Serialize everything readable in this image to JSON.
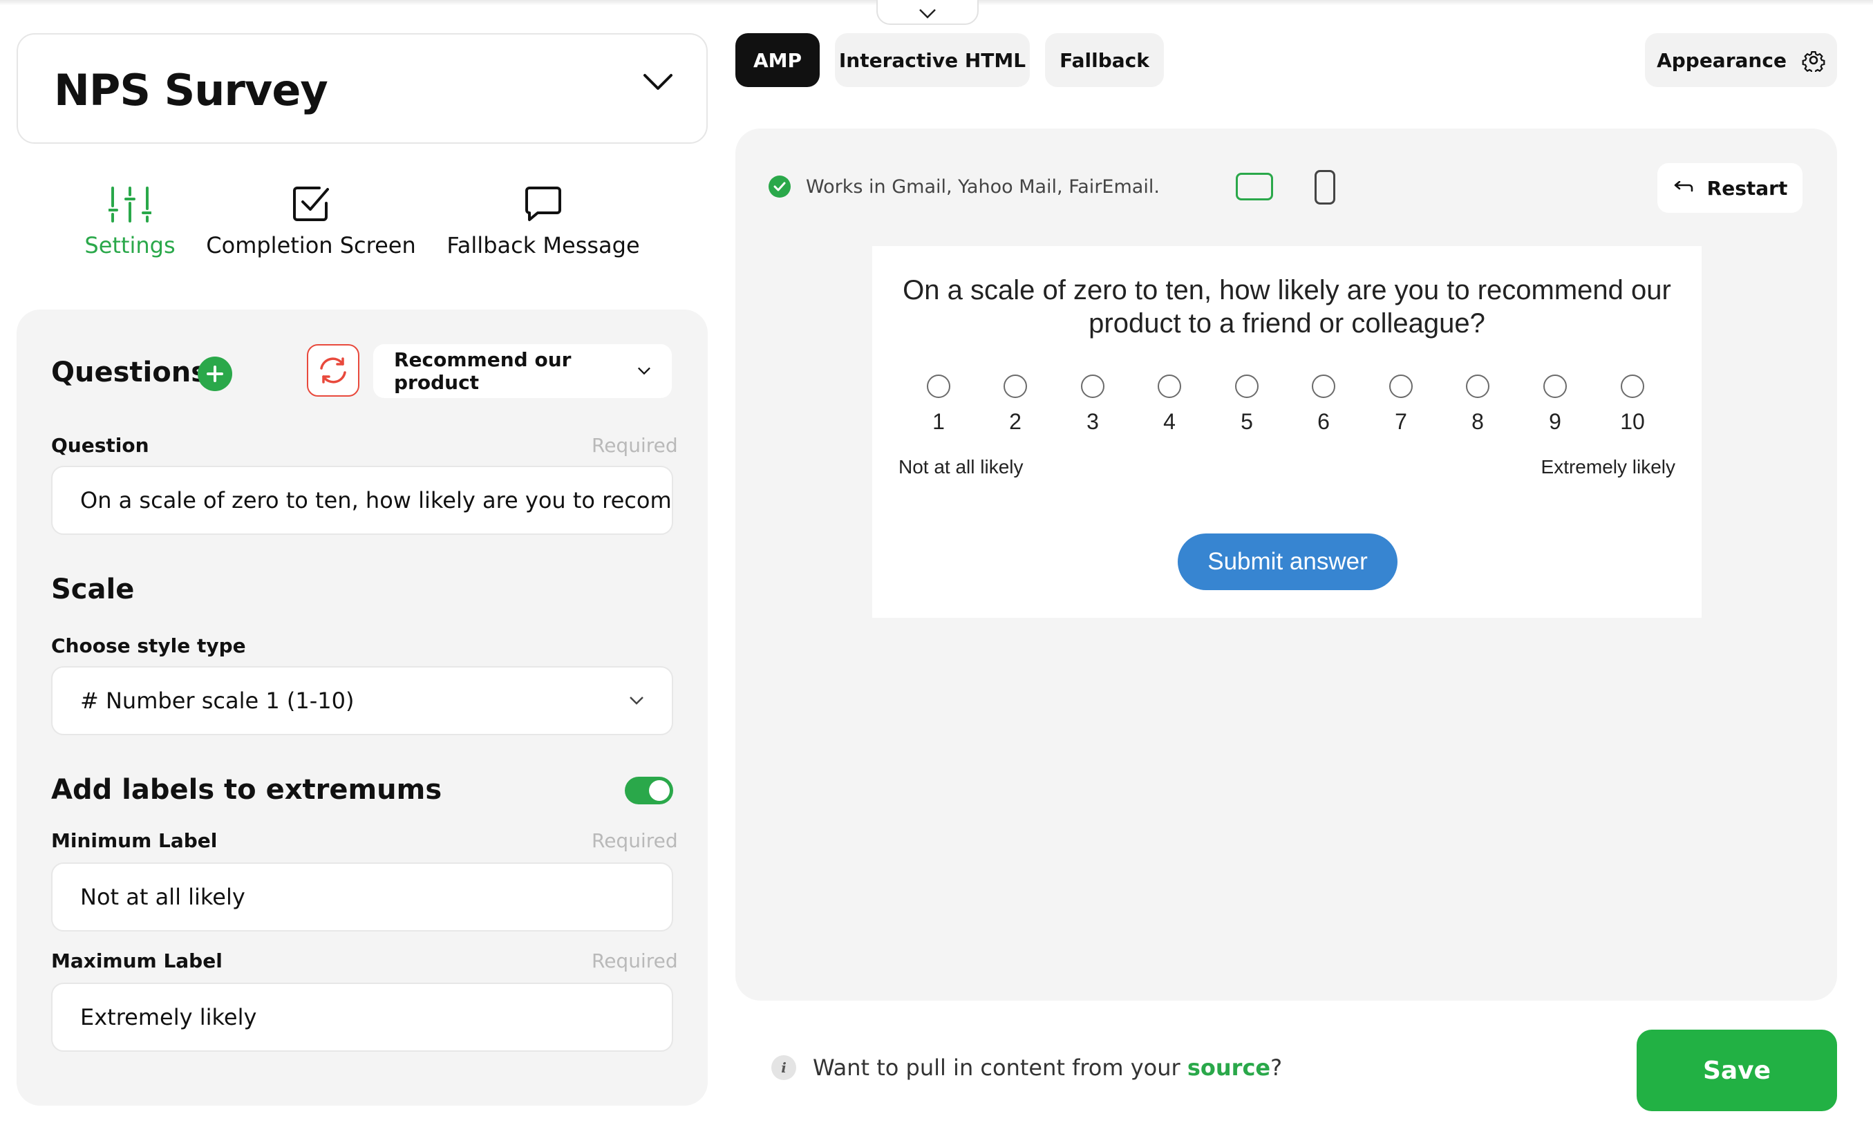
{
  "survey": {
    "title": "NPS Survey"
  },
  "nav": [
    {
      "label": "Settings",
      "icon": "sliders-icon",
      "active": true
    },
    {
      "label": "Completion Screen",
      "icon": "checkbox-icon",
      "active": false
    },
    {
      "label": "Fallback Message",
      "icon": "message-icon",
      "active": false
    }
  ],
  "questions": {
    "heading": "Questions",
    "selected": "Recommend our product",
    "question_label": "Question",
    "question_required": "Required",
    "question_value": "On a scale of zero to ten, how likely are you to recommend our product to a friend or colleague?",
    "scale_heading": "Scale",
    "style_label": "Choose style type",
    "style_value": "# Number scale 1 (1-10)",
    "extremums_heading": "Add labels to extremums",
    "extremums_enabled": true,
    "min_label": "Minimum Label",
    "min_required": "Required",
    "min_value": "Not at all likely",
    "max_label": "Maximum Label",
    "max_required": "Required",
    "max_value": "Extremely likely"
  },
  "tabs": {
    "items": [
      "AMP",
      "Interactive HTML",
      "Fallback"
    ],
    "active": "AMP",
    "appearance": "Appearance"
  },
  "preview": {
    "works_in": "Works in Gmail, Yahoo Mail, FairEmail.",
    "restart": "Restart",
    "question": "On a scale of zero to ten, how likely are you to recommend our product to a friend or colleague?",
    "scale": [
      "1",
      "2",
      "3",
      "4",
      "5",
      "6",
      "7",
      "8",
      "9",
      "10"
    ],
    "min_label": "Not at all likely",
    "max_label": "Extremely likely",
    "submit": "Submit answer"
  },
  "footer": {
    "info_prefix": "Want to pull in content from your ",
    "info_link": "source",
    "info_suffix": "?",
    "save": "Save"
  },
  "colors": {
    "accent": "#2aa84a",
    "submit": "#3785d1",
    "refresh": "#e8493c"
  }
}
